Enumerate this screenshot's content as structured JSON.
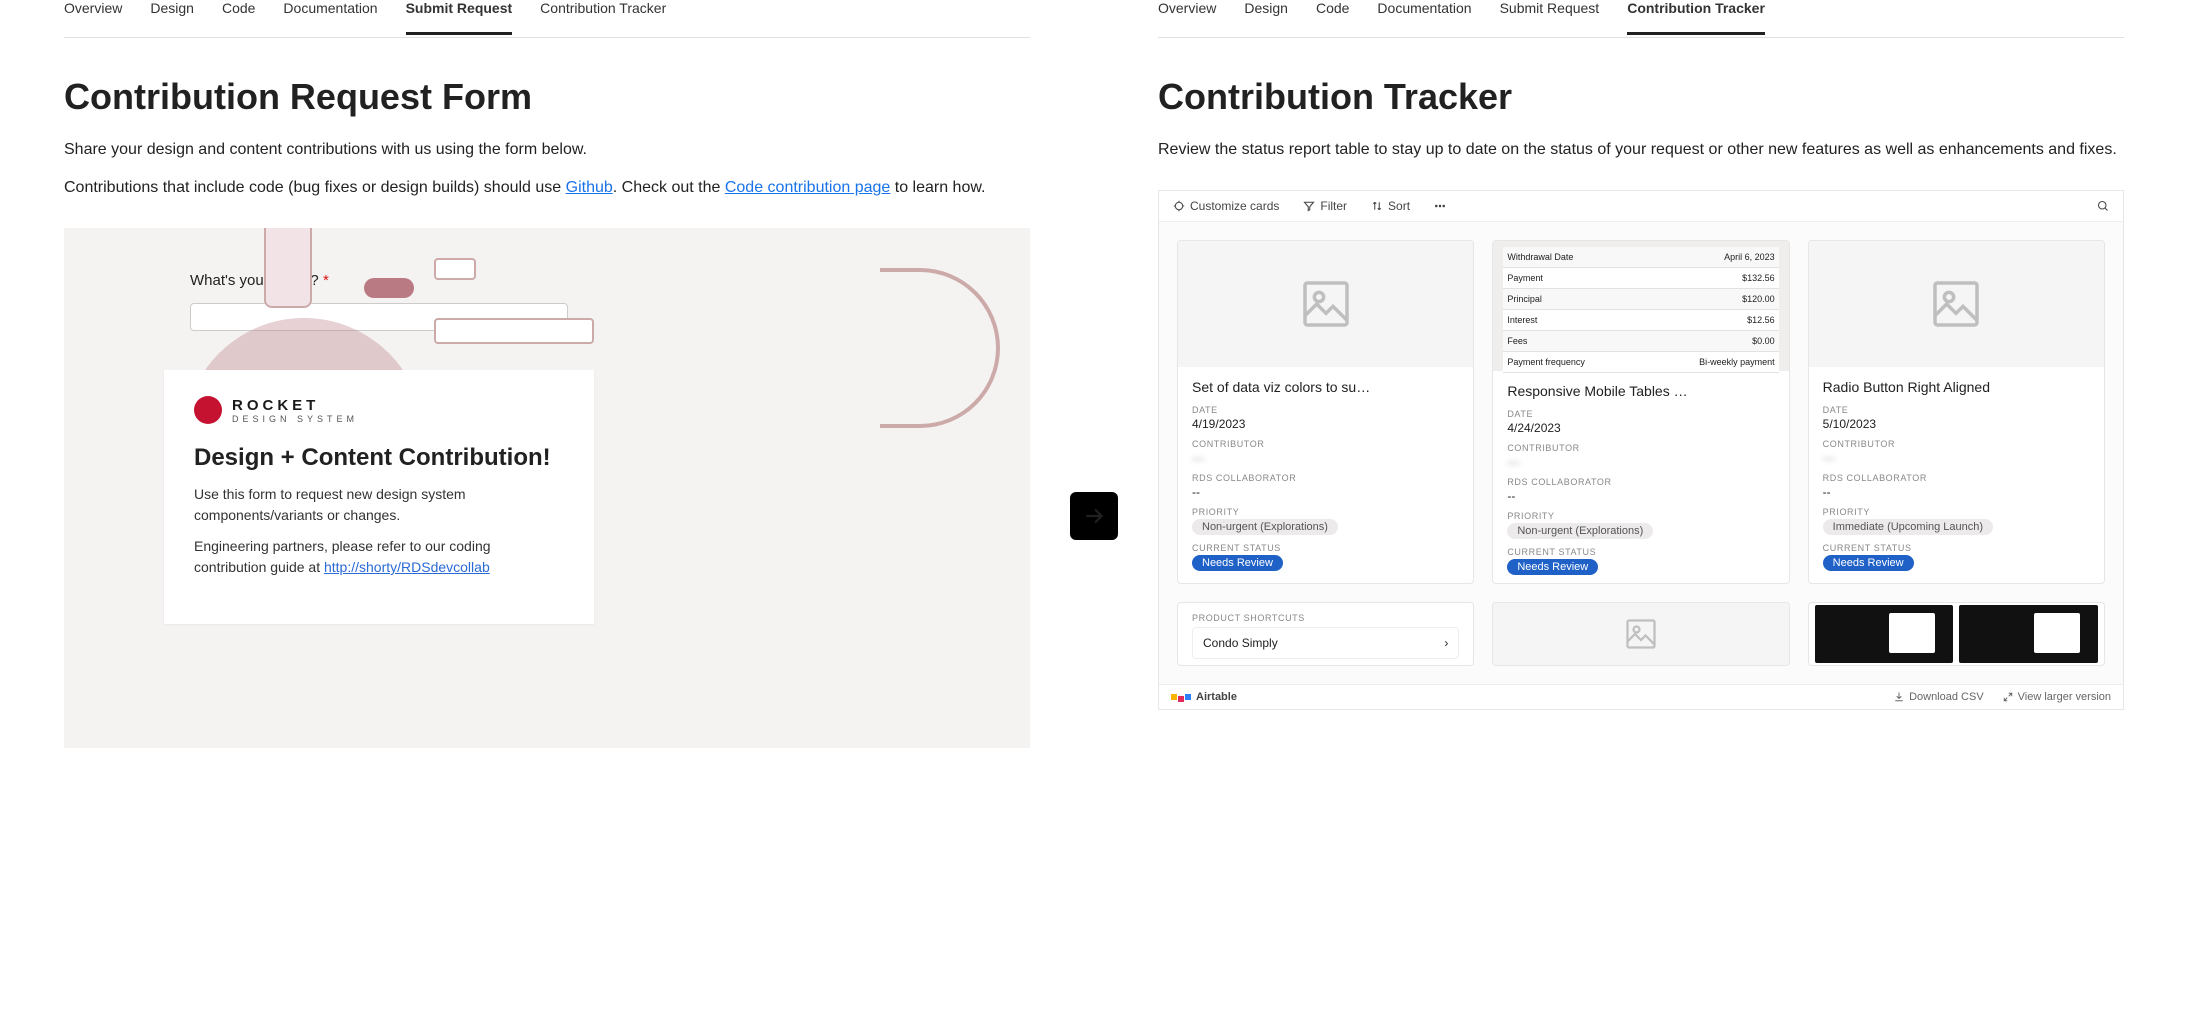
{
  "tabs": [
    "Overview",
    "Design",
    "Code",
    "Documentation",
    "Submit Request",
    "Contribution Tracker"
  ],
  "left": {
    "activeTab": "Submit Request",
    "heading": "Contribution Request Form",
    "intro1": "Share your design and content contributions with us using the form below.",
    "intro2a": "Contributions that include code (bug fixes or design builds) should use ",
    "link_github": "Github",
    "intro2b": ". Check out the ",
    "link_codepage": "Code contribution page",
    "intro2c": " to learn how.",
    "rocket_brand": "ROCKET",
    "rocket_sub": "DESIGN SYSTEM",
    "form_title": "Design + Content Contribution!",
    "form_desc1": "Use this form to request new design system components/variants or changes.",
    "form_desc2a": "Engineering partners, please refer to our coding contribution guide at ",
    "form_link": "http://shorty/RDSdevcollab",
    "name_label": "What's your name?"
  },
  "right": {
    "activeTab": "Contribution Tracker",
    "heading": "Contribution Tracker",
    "intro": "Review the status report table to stay up to date on the status of your request or other new features as well as enhancements and fixes.",
    "toolbar": {
      "customize": "Customize cards",
      "filter": "Filter",
      "sort": "Sort"
    },
    "labels": {
      "date": "Date",
      "contributor": "Contributor",
      "collaborator": "RDS Collaborator",
      "priority": "Priority",
      "status": "Current Status",
      "shortcuts": "Product Shortcuts"
    },
    "cards": [
      {
        "title": "Set of data viz colors to su…",
        "date": "4/19/2023",
        "contributor": "—",
        "collaborator": "--",
        "priority": "Non-urgent (Explorations)",
        "status": "Needs Review"
      },
      {
        "title": "Responsive Mobile Tables …",
        "date": "4/24/2023",
        "contributor": "—",
        "collaborator": "--",
        "priority": "Non-urgent (Explorations)",
        "status": "Needs Review"
      },
      {
        "title": "Radio Button Right Aligned",
        "date": "5/10/2023",
        "contributor": "—",
        "collaborator": "--",
        "priority": "Immediate (Upcoming Launch)",
        "status": "Needs Review"
      }
    ],
    "mini_table": [
      {
        "k": "Withdrawal Date",
        "v": "April 6, 2023"
      },
      {
        "k": "Payment",
        "v": "$132.56"
      },
      {
        "k": "Principal",
        "v": "$120.00"
      },
      {
        "k": "Interest",
        "v": "$12.56"
      },
      {
        "k": "Fees",
        "v": "$0.00"
      },
      {
        "k": "Payment frequency",
        "v": "Bi-weekly payment"
      }
    ],
    "shortcut_item": "Condo Simply",
    "bottom": {
      "airtable": "Airtable",
      "download": "Download CSV",
      "viewlarger": "View larger version"
    }
  }
}
